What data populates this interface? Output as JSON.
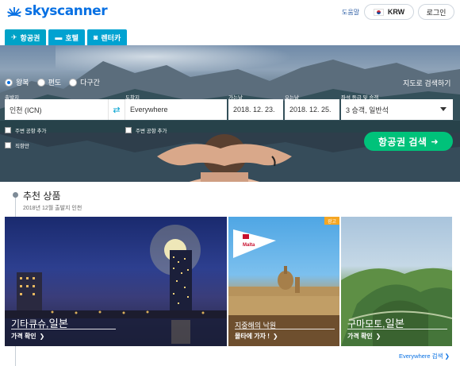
{
  "brand": {
    "name": "skyscanner"
  },
  "header": {
    "help": "도움말",
    "currency": "KRW",
    "login": "로그인"
  },
  "tabs": [
    {
      "label": "항공권",
      "icon": "plane-icon",
      "active": true
    },
    {
      "label": "호텔",
      "icon": "bed-icon",
      "active": false
    },
    {
      "label": "렌터카",
      "icon": "car-icon",
      "active": false
    }
  ],
  "search": {
    "trip_types": [
      {
        "label": "왕복",
        "selected": true
      },
      {
        "label": "편도",
        "selected": false
      },
      {
        "label": "다구간",
        "selected": false
      }
    ],
    "map_search": "지도로 검색하기",
    "from": {
      "label": "출발지",
      "value": "인천 (ICN)"
    },
    "to": {
      "label": "도착지",
      "value": "Everywhere"
    },
    "depart": {
      "label": "가는날",
      "value": "2018. 12. 23."
    },
    "return": {
      "label": "오는날",
      "value": "2018. 12. 25."
    },
    "cabin": {
      "label": "좌석 등급 및 승객",
      "value": "3 승객, 일반석"
    },
    "nearby_from": "주변 공항 추가",
    "nearby_to": "주변 공항 추가",
    "direct_only": "직항만",
    "submit": "항공권 검색"
  },
  "recommendations": {
    "title": "추천 상품",
    "subtitle": "2018년 12월   출발지 인천",
    "cards": [
      {
        "name": "기타큐슈,",
        "country": "일본",
        "cta": "가격 확인"
      },
      {
        "name": "지중해의 낙원",
        "country": "",
        "cta": "몰타에 가자 !",
        "ad": "광고",
        "logo_text": "Malta"
      },
      {
        "name": "구마모토,",
        "country": "일본",
        "cta": "가격 확인"
      }
    ],
    "more": "Everywhere 검색"
  },
  "colors": {
    "brand_blue": "#0770e3",
    "tab_teal": "#00a2d1",
    "search_green": "#00c27a",
    "ad_orange": "#f5a623"
  }
}
